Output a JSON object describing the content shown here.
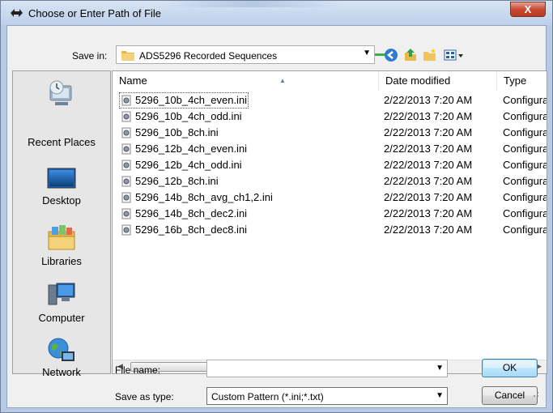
{
  "window": {
    "title": "Choose or Enter Path of File",
    "close_label": "X"
  },
  "toolbar": {
    "save_in_label": "Save in:",
    "save_in_value": "ADS5296 Recorded Sequences",
    "icons": [
      "back-icon",
      "up-folder-icon",
      "new-folder-icon",
      "view-menu-icon"
    ]
  },
  "places": [
    {
      "label": "Recent Places",
      "icon": "recent-places-icon"
    },
    {
      "label": "Desktop",
      "icon": "desktop-icon"
    },
    {
      "label": "Libraries",
      "icon": "libraries-icon"
    },
    {
      "label": "Computer",
      "icon": "computer-icon"
    },
    {
      "label": "Network",
      "icon": "network-icon"
    }
  ],
  "columns": [
    "Name",
    "Date modified",
    "Type"
  ],
  "files": [
    {
      "name": "5296_10b_4ch_even.ini",
      "date": "2/22/2013 7:20 AM",
      "type": "Configura"
    },
    {
      "name": "5296_10b_4ch_odd.ini",
      "date": "2/22/2013 7:20 AM",
      "type": "Configura"
    },
    {
      "name": "5296_10b_8ch.ini",
      "date": "2/22/2013 7:20 AM",
      "type": "Configura"
    },
    {
      "name": "5296_12b_4ch_even.ini",
      "date": "2/22/2013 7:20 AM",
      "type": "Configura"
    },
    {
      "name": "5296_12b_4ch_odd.ini",
      "date": "2/22/2013 7:20 AM",
      "type": "Configura"
    },
    {
      "name": "5296_12b_8ch.ini",
      "date": "2/22/2013 7:20 AM",
      "type": "Configura"
    },
    {
      "name": "5296_14b_8ch_avg_ch1,2.ini",
      "date": "2/22/2013 7:20 AM",
      "type": "Configura"
    },
    {
      "name": "5296_14b_8ch_dec2.ini",
      "date": "2/22/2013 7:20 AM",
      "type": "Configura"
    },
    {
      "name": "5296_16b_8ch_dec8.ini",
      "date": "2/22/2013 7:20 AM",
      "type": "Configura"
    }
  ],
  "bottom": {
    "file_name_label": "File name:",
    "file_name_value": "",
    "save_as_type_label": "Save as type:",
    "save_as_type_value": "Custom Pattern (*.ini;*.txt)",
    "ok_label": "OK",
    "cancel_label": "Cancel"
  }
}
